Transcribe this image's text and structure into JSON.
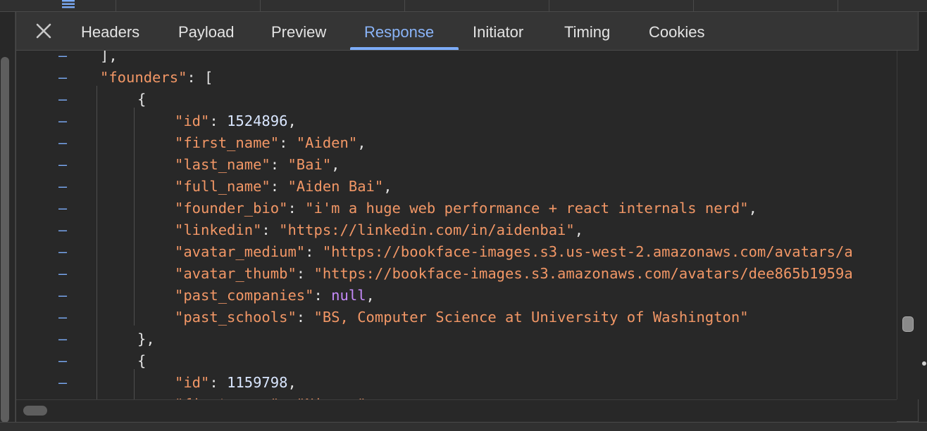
{
  "tabs": [
    {
      "label": "Headers",
      "active": false
    },
    {
      "label": "Payload",
      "active": false
    },
    {
      "label": "Preview",
      "active": false
    },
    {
      "label": "Response",
      "active": true
    },
    {
      "label": "Initiator",
      "active": false
    },
    {
      "label": "Timing",
      "active": false
    },
    {
      "label": "Cookies",
      "active": false
    }
  ],
  "colors": {
    "active_tab": "#8ab4f8",
    "json_key": "#f29766",
    "json_string": "#f29766",
    "json_number": "#d9e6ff",
    "json_null": "#c58af9",
    "fold_marker": "#7cacf8"
  },
  "fold_marker": "–",
  "response_lines": [
    {
      "indent": 1,
      "tokens": [
        {
          "t": "p",
          "v": "],"
        }
      ]
    },
    {
      "indent": 1,
      "tokens": [
        {
          "t": "k",
          "v": "\"founders\""
        },
        {
          "t": "p",
          "v": ": ["
        }
      ]
    },
    {
      "indent": 2,
      "tokens": [
        {
          "t": "p",
          "v": "{"
        }
      ]
    },
    {
      "indent": 3,
      "tokens": [
        {
          "t": "k",
          "v": "\"id\""
        },
        {
          "t": "p",
          "v": ": "
        },
        {
          "t": "n",
          "v": "1524896"
        },
        {
          "t": "p",
          "v": ","
        }
      ]
    },
    {
      "indent": 3,
      "tokens": [
        {
          "t": "k",
          "v": "\"first_name\""
        },
        {
          "t": "p",
          "v": ": "
        },
        {
          "t": "s",
          "v": "\"Aiden\""
        },
        {
          "t": "p",
          "v": ","
        }
      ]
    },
    {
      "indent": 3,
      "tokens": [
        {
          "t": "k",
          "v": "\"last_name\""
        },
        {
          "t": "p",
          "v": ": "
        },
        {
          "t": "s",
          "v": "\"Bai\""
        },
        {
          "t": "p",
          "v": ","
        }
      ]
    },
    {
      "indent": 3,
      "tokens": [
        {
          "t": "k",
          "v": "\"full_name\""
        },
        {
          "t": "p",
          "v": ": "
        },
        {
          "t": "s",
          "v": "\"Aiden Bai\""
        },
        {
          "t": "p",
          "v": ","
        }
      ]
    },
    {
      "indent": 3,
      "tokens": [
        {
          "t": "k",
          "v": "\"founder_bio\""
        },
        {
          "t": "p",
          "v": ": "
        },
        {
          "t": "s",
          "v": "\"i'm a huge web performance + react internals nerd\""
        },
        {
          "t": "p",
          "v": ","
        }
      ]
    },
    {
      "indent": 3,
      "tokens": [
        {
          "t": "k",
          "v": "\"linkedin\""
        },
        {
          "t": "p",
          "v": ": "
        },
        {
          "t": "s",
          "v": "\"https://linkedin.com/in/aidenbai\""
        },
        {
          "t": "p",
          "v": ","
        }
      ]
    },
    {
      "indent": 3,
      "tokens": [
        {
          "t": "k",
          "v": "\"avatar_medium\""
        },
        {
          "t": "p",
          "v": ": "
        },
        {
          "t": "s",
          "v": "\"https://bookface-images.s3.us-west-2.amazonaws.com/avatars/a"
        }
      ]
    },
    {
      "indent": 3,
      "tokens": [
        {
          "t": "k",
          "v": "\"avatar_thumb\""
        },
        {
          "t": "p",
          "v": ": "
        },
        {
          "t": "s",
          "v": "\"https://bookface-images.s3.amazonaws.com/avatars/dee865b1959a"
        }
      ]
    },
    {
      "indent": 3,
      "tokens": [
        {
          "t": "k",
          "v": "\"past_companies\""
        },
        {
          "t": "p",
          "v": ": "
        },
        {
          "t": "nl",
          "v": "null"
        },
        {
          "t": "p",
          "v": ","
        }
      ]
    },
    {
      "indent": 3,
      "tokens": [
        {
          "t": "k",
          "v": "\"past_schools\""
        },
        {
          "t": "p",
          "v": ": "
        },
        {
          "t": "s",
          "v": "\"BS, Computer Science at University of Washington\""
        }
      ]
    },
    {
      "indent": 2,
      "tokens": [
        {
          "t": "p",
          "v": "},"
        }
      ]
    },
    {
      "indent": 2,
      "tokens": [
        {
          "t": "p",
          "v": "{"
        }
      ]
    },
    {
      "indent": 3,
      "tokens": [
        {
          "t": "k",
          "v": "\"id\""
        },
        {
          "t": "p",
          "v": ": "
        },
        {
          "t": "n",
          "v": "1159798"
        },
        {
          "t": "p",
          "v": ","
        }
      ]
    },
    {
      "indent": 3,
      "tokens": [
        {
          "t": "k",
          "v": "\"first_name\""
        },
        {
          "t": "p",
          "v": ": "
        },
        {
          "t": "s",
          "v": "\"Nicora\""
        }
      ]
    }
  ]
}
